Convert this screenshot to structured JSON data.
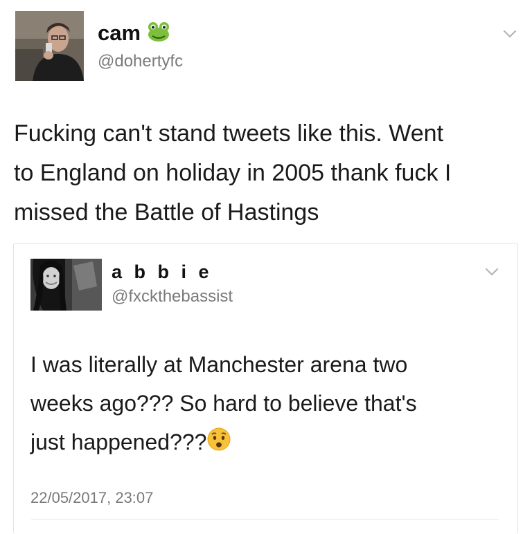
{
  "outer_tweet": {
    "display_name": "cam",
    "name_emoji": "frog-emoji",
    "handle": "@dohertyfc",
    "text_lines": [
      "Fucking can't stand tweets like this. Went",
      "to England on holiday in 2005 thank fuck I",
      "missed the Battle of Hastings"
    ]
  },
  "quoted_tweet": {
    "display_name": "a b b i e",
    "handle": "@fxckthebassist",
    "text_lines": [
      "I was literally at Manchester arena two",
      "weeks ago??? So hard to believe that's",
      "just happened???"
    ],
    "text_emoji": "hushed-face-emoji",
    "timestamp": "22/05/2017, 23:07"
  },
  "colors": {
    "text": "#1a1a1a",
    "secondary_text": "#7a7a7a",
    "card_border": "#e3e3e3",
    "chevron": "#b5b5b5"
  }
}
